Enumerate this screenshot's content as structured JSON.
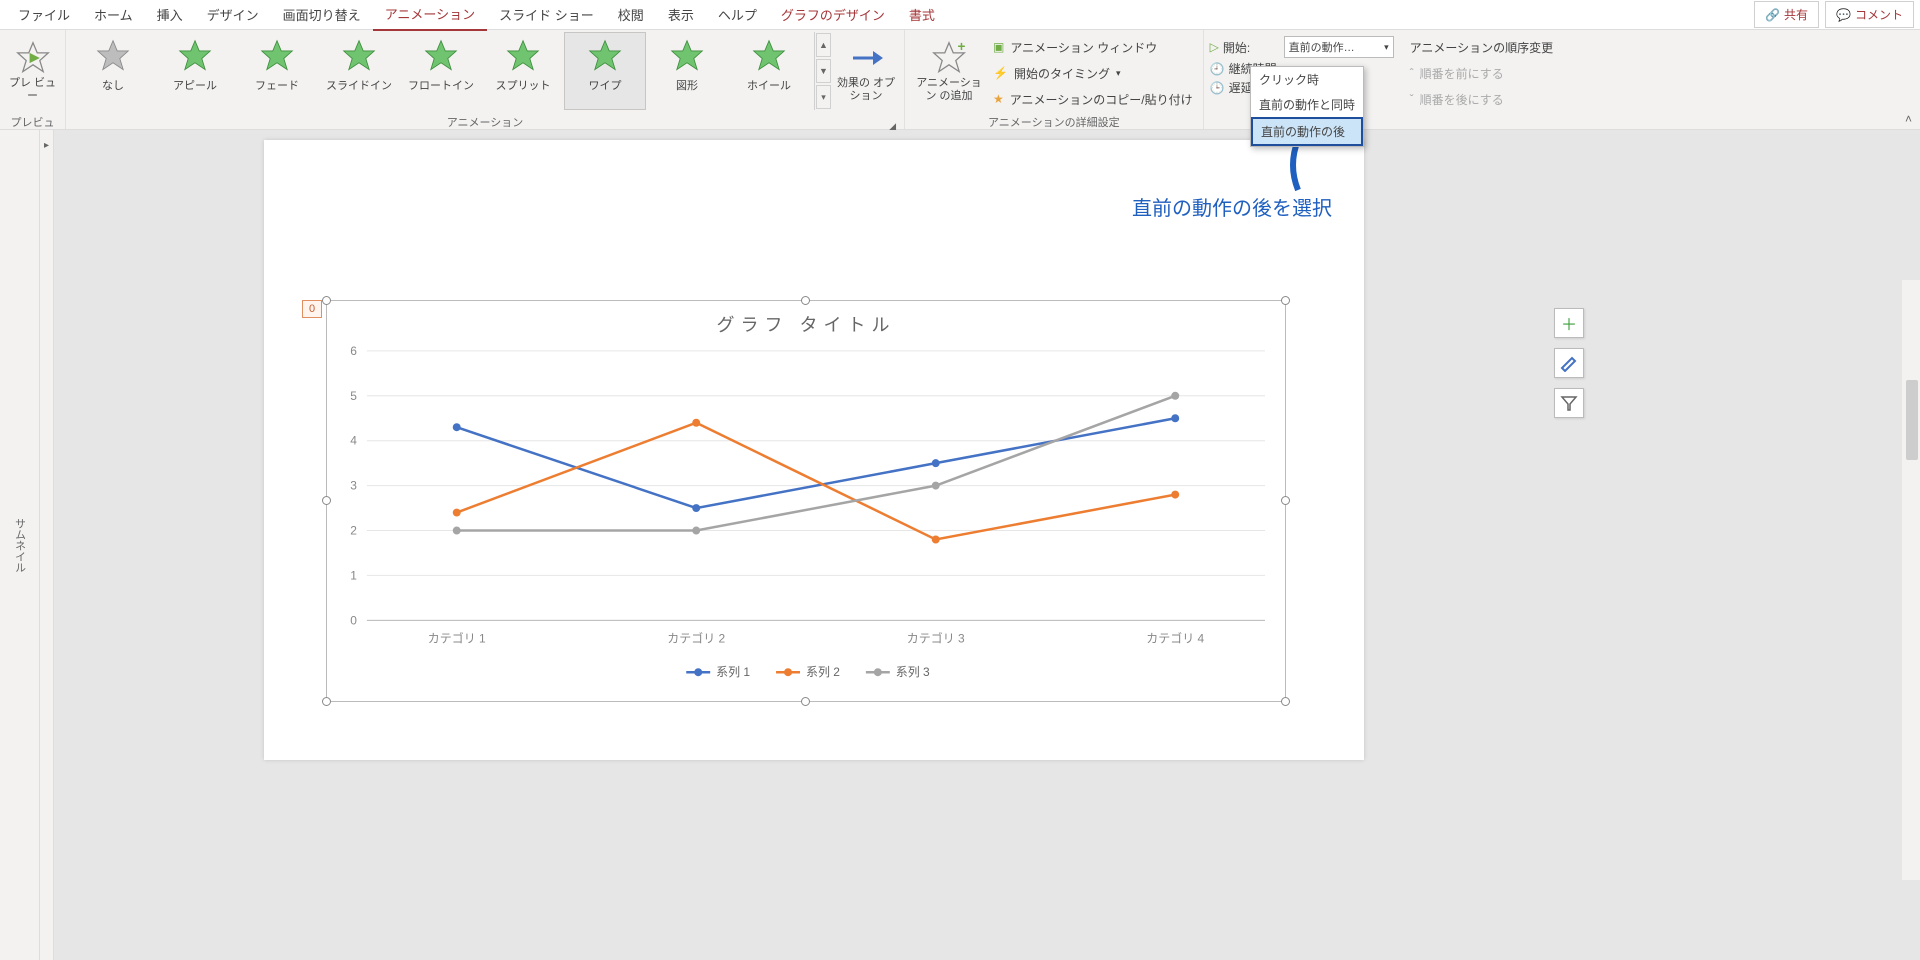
{
  "tabs": {
    "file": "ファイル",
    "home": "ホーム",
    "insert": "挿入",
    "design": "デザイン",
    "transition": "画面切り替え",
    "animation": "アニメーション",
    "slideshow": "スライド ショー",
    "review": "校閲",
    "view": "表示",
    "help": "ヘルプ",
    "chartdesign": "グラフのデザイン",
    "format": "書式",
    "share": "共有",
    "comment": "コメント"
  },
  "ribbon": {
    "preview_group": "プレビュー",
    "preview_btn": "プレ\nビュー",
    "anim_group": "アニメーション",
    "anim_items": [
      "なし",
      "アピール",
      "フェード",
      "スライドイン",
      "フロートイン",
      "スプリット",
      "ワイプ",
      "図形",
      "ホイール"
    ],
    "selected_anim_index": 6,
    "effect_options": "効果の\nオプション",
    "add_anim": "アニメーション\nの追加",
    "adv_group": "アニメーションの詳細設定",
    "anim_pane": "アニメーション ウィンドウ",
    "trigger": "開始のタイミング",
    "copy": "アニメーションのコピー/貼り付け",
    "timing": {
      "start": "開始:",
      "duration": "継続時間",
      "delay": "遅延:",
      "start_value": "直前の動作…"
    },
    "reorder": "アニメーションの順序変更",
    "move_earlier": "順番を前にする",
    "move_later": "順番を後にする",
    "dropdown": [
      "クリック時",
      "直前の動作と同時",
      "直前の動作の後"
    ],
    "dropdown_sel": 2
  },
  "annotation": "直前の動作の後を選択",
  "thumbnail_label": "サムネイル",
  "chart_object": {
    "tag": "0",
    "float_buttons": {
      "plus": "＋",
      "brush": "brush",
      "filter": "filter"
    }
  },
  "chart_data": {
    "type": "line",
    "title": "グラフ タイトル",
    "categories": [
      "カテゴリ 1",
      "カテゴリ 2",
      "カテゴリ 3",
      "カテゴリ 4"
    ],
    "series": [
      {
        "name": "系列 1",
        "values": [
          4.3,
          2.5,
          3.5,
          4.5
        ],
        "color": "#4472c4"
      },
      {
        "name": "系列 2",
        "values": [
          2.4,
          4.4,
          1.8,
          2.8
        ],
        "color": "#ed7d31"
      },
      {
        "name": "系列 3",
        "values": [
          2.0,
          2.0,
          3.0,
          5.0
        ],
        "color": "#a5a5a5"
      }
    ],
    "ylim": [
      0,
      6
    ],
    "yticks": [
      0,
      1,
      2,
      3,
      4,
      5,
      6
    ]
  }
}
